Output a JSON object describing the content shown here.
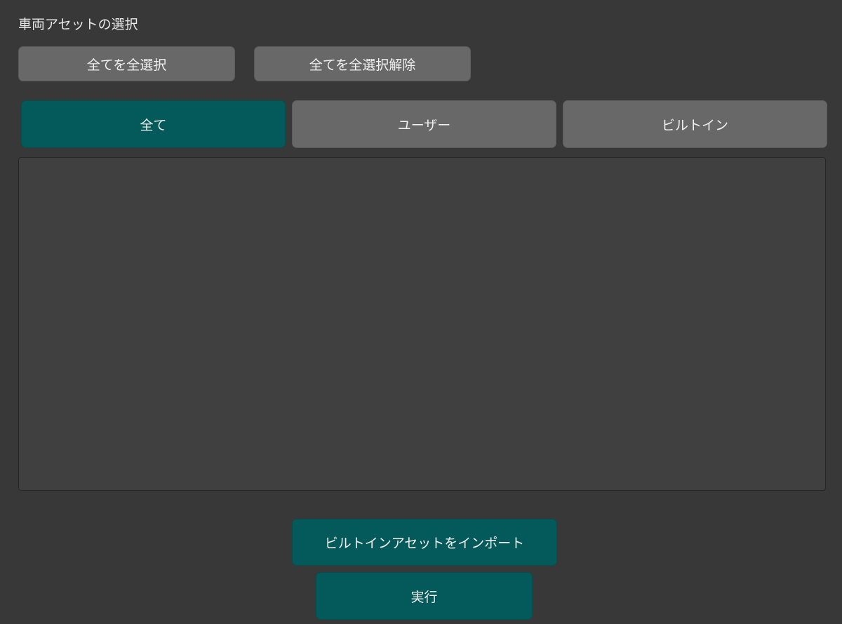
{
  "section": {
    "title": "車両アセットの選択"
  },
  "selection": {
    "select_all_label": "全てを全選択",
    "deselect_all_label": "全てを全選択解除"
  },
  "tabs": [
    {
      "label": "全て",
      "active": true
    },
    {
      "label": "ユーザー",
      "active": false
    },
    {
      "label": "ビルトイン",
      "active": false
    }
  ],
  "asset_list": {
    "items": []
  },
  "actions": {
    "import_builtin_label": "ビルトインアセットをインポート",
    "execute_label": "実行"
  },
  "colors": {
    "background": "#383838",
    "button_gray": "#686868",
    "accent_teal": "#045a5a",
    "list_background": "#404040"
  }
}
